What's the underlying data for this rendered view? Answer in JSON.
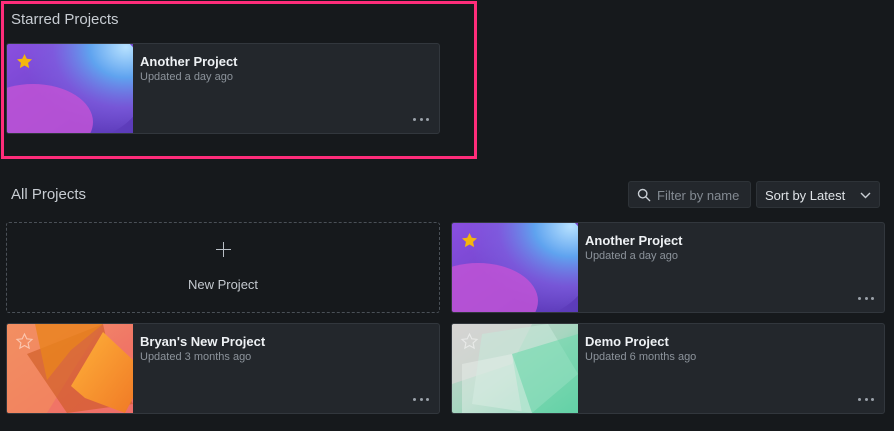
{
  "starred": {
    "title": "Starred Projects",
    "projects": [
      {
        "name": "Another Project",
        "updated": "Updated a day ago",
        "starred": true
      }
    ]
  },
  "all": {
    "title": "All Projects",
    "filter": {
      "placeholder": "Filter by name",
      "value": ""
    },
    "sort": {
      "label": "Sort by Latest"
    },
    "new_project": {
      "label": "New Project"
    },
    "projects": [
      {
        "name": "Another Project",
        "updated": "Updated a day ago",
        "starred": true
      },
      {
        "name": "Bryan's New Project",
        "updated": "Updated 3 months ago",
        "starred": false
      },
      {
        "name": "Demo Project",
        "updated": "Updated 6 months ago",
        "starred": false
      }
    ]
  },
  "colors": {
    "background": "#16191c",
    "card": "#23272c",
    "highlight": "#ff2d7a",
    "star": "#f5b60c"
  }
}
